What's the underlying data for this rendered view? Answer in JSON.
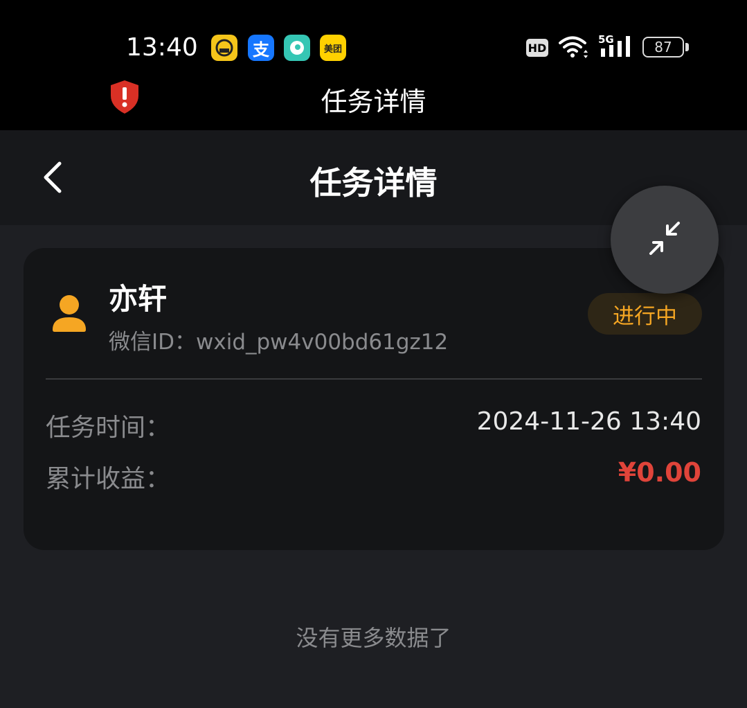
{
  "status_bar": {
    "time": "13:40",
    "hd_label": "HD",
    "network_label": "5G",
    "battery_level": "87",
    "apps": [
      {
        "name": "car-app-icon",
        "glyph": "⌂"
      },
      {
        "name": "alipay-icon",
        "glyph": "支"
      },
      {
        "name": "soul-app-icon",
        "glyph": "◉"
      },
      {
        "name": "meituan-icon",
        "glyph": "美团"
      }
    ]
  },
  "system_title": "任务详情",
  "nav": {
    "title": "任务详情"
  },
  "card": {
    "user_name": "亦轩",
    "wechat_id": "微信ID：wxid_pw4v00bd61gz12",
    "status": "进行中",
    "rows": [
      {
        "label": "任务时间：",
        "value": "2024-11-26 13:40"
      },
      {
        "label": "累计收益：",
        "value": "¥0.00"
      }
    ]
  },
  "footer_text": "没有更多数据了",
  "colors": {
    "accent_orange": "#f5a623",
    "earnings_red": "#e0443a",
    "alert_red": "#d93025"
  }
}
